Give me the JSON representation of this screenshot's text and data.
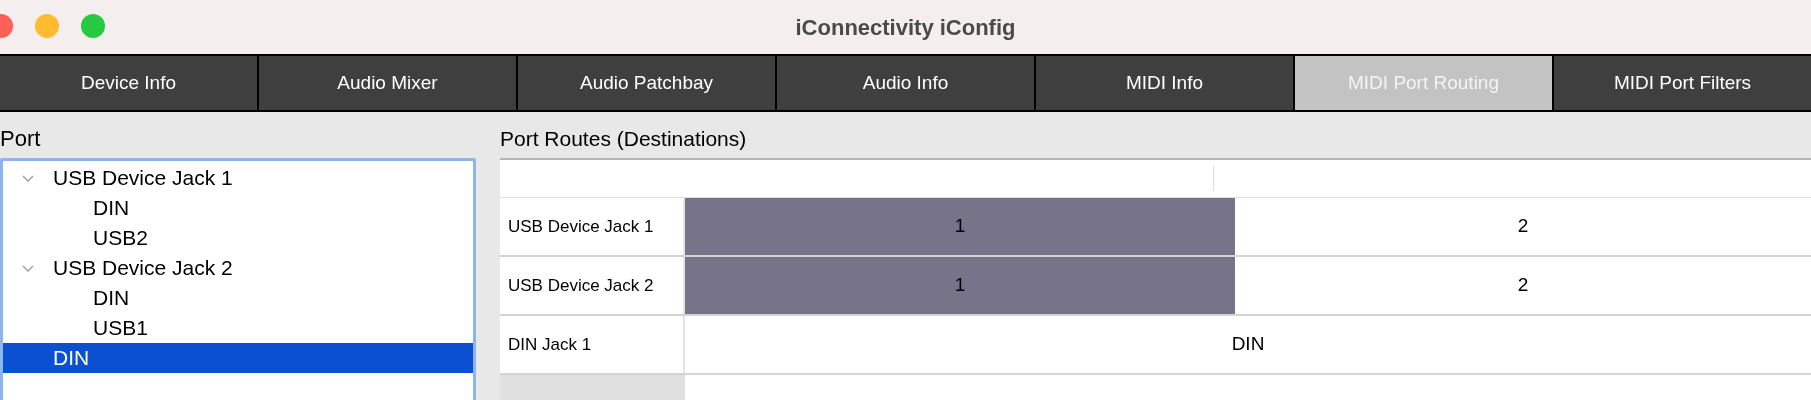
{
  "window": {
    "title": "iConnectivity iConfig"
  },
  "tabs": [
    {
      "label": "Device Info",
      "selected": false
    },
    {
      "label": "Audio Mixer",
      "selected": false
    },
    {
      "label": "Audio Patchbay",
      "selected": false
    },
    {
      "label": "Audio Info",
      "selected": false
    },
    {
      "label": "MIDI Info",
      "selected": false
    },
    {
      "label": "MIDI Port Routing",
      "selected": true
    },
    {
      "label": "MIDI Port Filters",
      "selected": false
    }
  ],
  "port_panel": {
    "title": "Port",
    "tree": [
      {
        "label": "USB Device Jack 1",
        "expanded": true,
        "selected": false,
        "children": [
          {
            "label": "DIN",
            "selected": false
          },
          {
            "label": "USB2",
            "selected": false
          }
        ]
      },
      {
        "label": "USB Device Jack 2",
        "expanded": true,
        "selected": false,
        "children": [
          {
            "label": "DIN",
            "selected": false
          },
          {
            "label": "USB1",
            "selected": false
          }
        ]
      },
      {
        "label": "DIN",
        "selected": true
      }
    ]
  },
  "routes_panel": {
    "title": "Port Routes (Destinations)",
    "rows": [
      {
        "label": "USB Device Jack 1",
        "cells": [
          {
            "text": "1",
            "kind": "single",
            "selected": true
          },
          {
            "text": "2",
            "kind": "single",
            "selected": false
          }
        ]
      },
      {
        "label": "USB Device Jack 2",
        "cells": [
          {
            "text": "1",
            "kind": "single",
            "selected": true
          },
          {
            "text": "2",
            "kind": "single",
            "selected": false
          }
        ]
      },
      {
        "label": "DIN Jack 1",
        "cells": [
          {
            "text": "DIN",
            "kind": "merged",
            "selected": false
          }
        ]
      }
    ]
  }
}
